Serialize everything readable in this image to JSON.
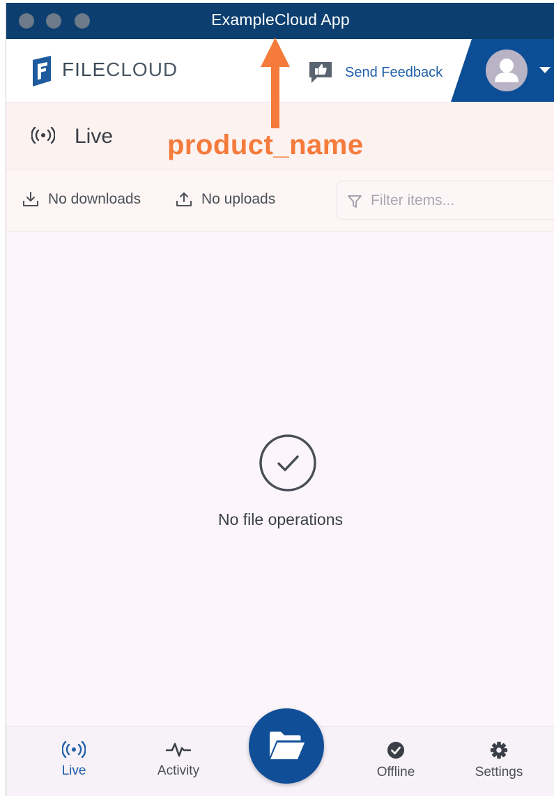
{
  "window": {
    "title": "ExampleCloud App"
  },
  "header": {
    "logo_text_bold": "FILE",
    "logo_text_rest": "CLOUD",
    "feedback_label": "Send Feedback",
    "accent_color": "#0c4e96"
  },
  "annotation": {
    "label": "product_name",
    "color": "#f47b3b"
  },
  "live": {
    "title": "Live",
    "icon": "broadcast-icon"
  },
  "toolbar": {
    "downloads_label": "No downloads",
    "uploads_label": "No uploads",
    "filter_placeholder": "Filter items..."
  },
  "empty_state": {
    "icon": "check-circle-icon",
    "message": "No file operations"
  },
  "bottom_nav": {
    "items": [
      {
        "label": "Live",
        "icon": "broadcast-icon",
        "active": true
      },
      {
        "label": "Activity",
        "icon": "pulse-icon",
        "active": false
      },
      {
        "label": "Offline",
        "icon": "check-badge-icon",
        "active": false
      },
      {
        "label": "Settings",
        "icon": "gear-icon",
        "active": false
      }
    ],
    "fab_icon": "folder-open-icon"
  }
}
